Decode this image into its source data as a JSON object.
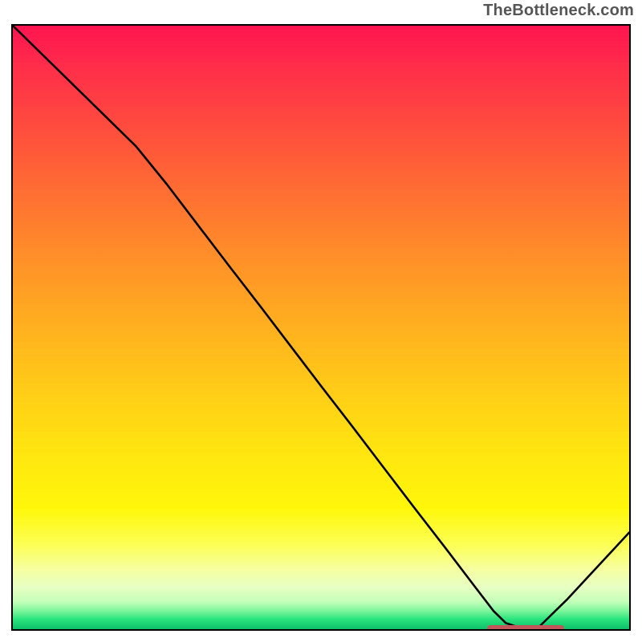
{
  "watermark": "TheBottleneck.com",
  "chart_data": {
    "type": "line",
    "title": "",
    "xlabel": "",
    "ylabel": "",
    "x": [
      0,
      5,
      10,
      15,
      20,
      25,
      30,
      35,
      40,
      45,
      50,
      55,
      60,
      65,
      70,
      75,
      78,
      80,
      83,
      85,
      90,
      95,
      100
    ],
    "values": [
      100,
      95,
      90,
      85,
      80,
      73.7,
      67,
      60.3,
      53.7,
      47,
      40.3,
      33.7,
      27,
      20.3,
      13.7,
      7,
      3,
      1,
      0,
      0,
      5,
      10.5,
      16
    ],
    "xlim": [
      0,
      100
    ],
    "ylim": [
      0,
      100
    ],
    "marker": {
      "x_start": 76.5,
      "x_end": 89,
      "y": 0.7
    },
    "background": "red-yellow-green vertical gradient"
  }
}
